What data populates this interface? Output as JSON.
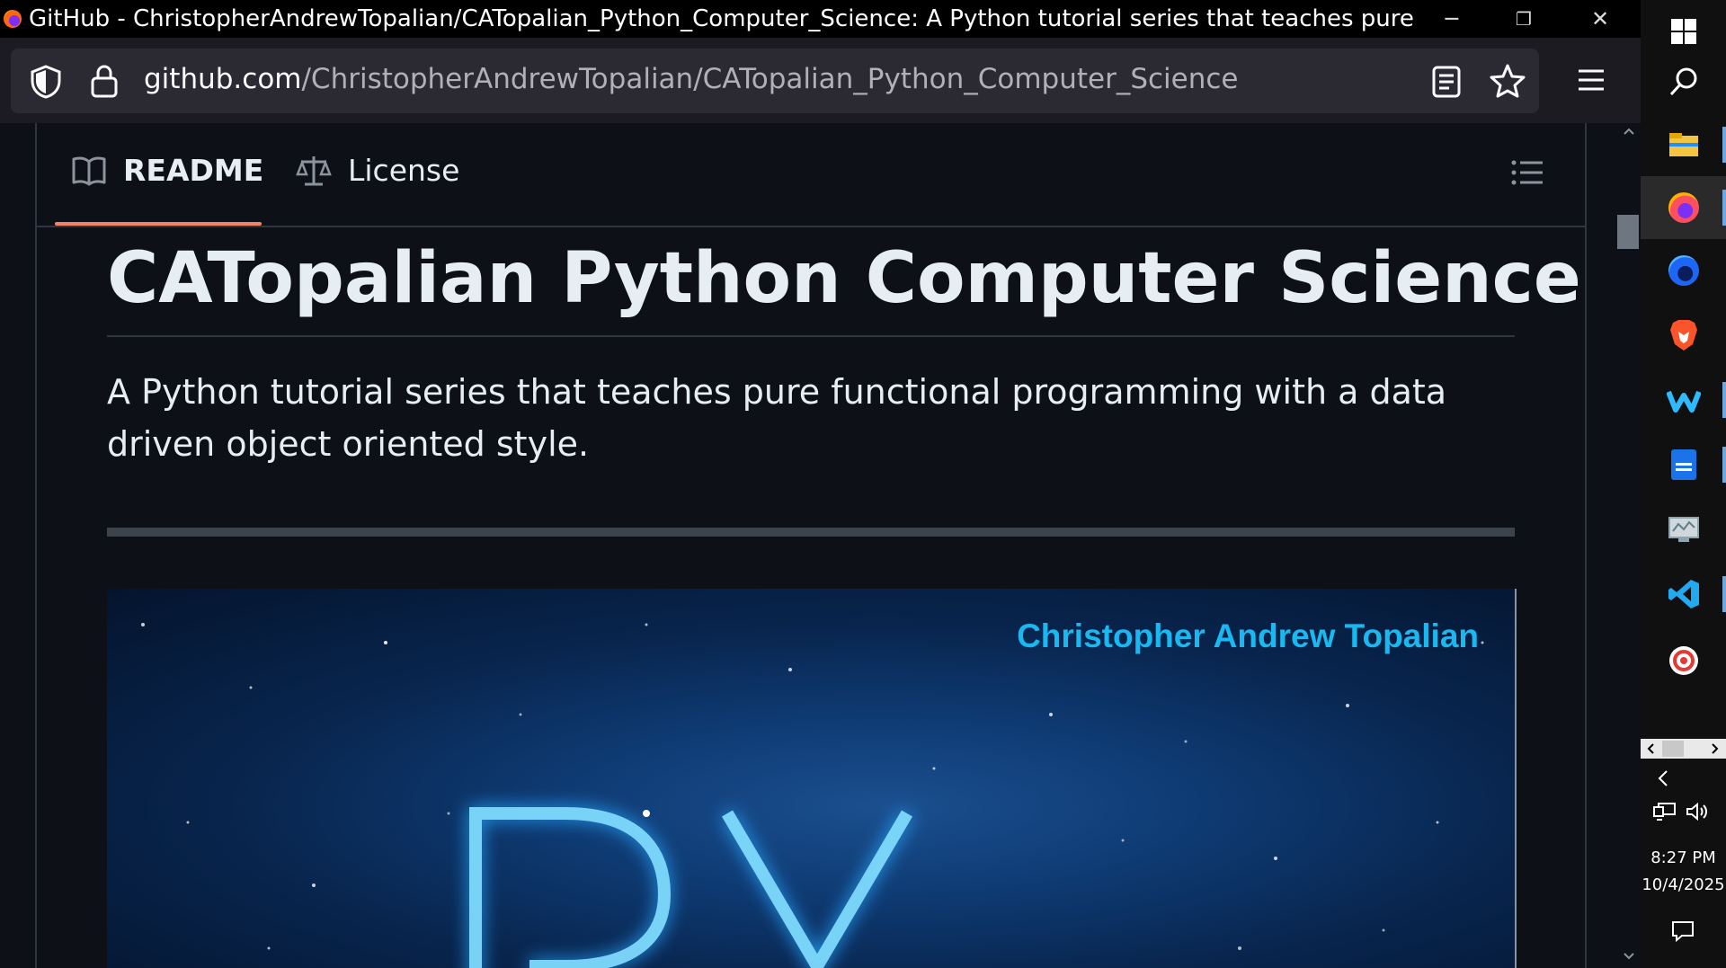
{
  "window": {
    "title": "GitHub - ChristopherAndrewTopalian/CATopalian_Python_Computer_Science: A Python tutorial series that teaches pure fun...",
    "minimize_glyph": "─",
    "restore_glyph": "❐",
    "close_glyph": "✕"
  },
  "urlbar": {
    "domain": "github.com",
    "path": "/ChristopherAndrewTopalian/CATopalian_Python_Computer_Science"
  },
  "readme": {
    "tabs": [
      {
        "label": "README",
        "icon": "book-icon",
        "active": true
      },
      {
        "label": "License",
        "icon": "scale-icon",
        "active": false
      }
    ],
    "title": "CATopalian Python Computer Science",
    "description": "A Python tutorial series that teaches pure functional programming with a data driven object oriented style.",
    "banner_author": "Christopher Andrew Topalian",
    "banner_logo_text": "PY"
  },
  "taskbar": {
    "apps": [
      {
        "name": "windows-start-icon"
      },
      {
        "name": "search-icon"
      },
      {
        "name": "file-explorer-icon"
      },
      {
        "name": "firefox-icon"
      },
      {
        "name": "firefox-developer-icon"
      },
      {
        "name": "brave-browser-icon"
      },
      {
        "name": "wave-app-icon"
      },
      {
        "name": "document-app-icon"
      },
      {
        "name": "monitor-app-icon"
      },
      {
        "name": "vscode-icon"
      },
      {
        "name": "red-circle-app-icon"
      }
    ],
    "time": "8:27 PM",
    "date": "10/4/2025"
  },
  "colors": {
    "accent_underline": "#f78166",
    "banner_author": "#1ab8f0",
    "page_bg": "#0d1117"
  }
}
